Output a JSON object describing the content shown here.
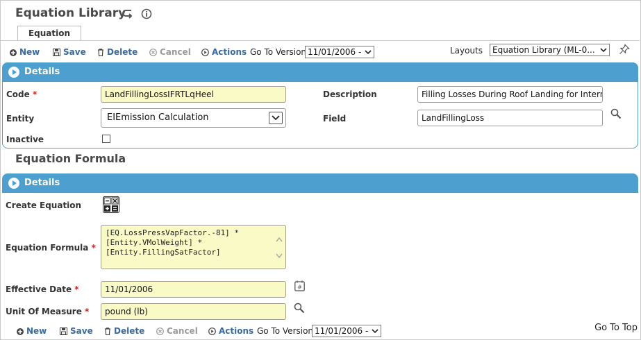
{
  "page": {
    "title": "Equation Library",
    "tab": "Equation"
  },
  "toolbar": {
    "new_label": "New",
    "save_label": "Save",
    "delete_label": "Delete",
    "cancel_label": "Cancel",
    "actions_label": "Actions",
    "goto_version_label": "Go To Version",
    "goto_version_value": "11/01/2006 -",
    "layouts_label": "Layouts",
    "layouts_value": "Equation Library (ML-0..."
  },
  "details": {
    "header": "Details",
    "code_label": "Code",
    "code_value": "LandFillingLossIFRTLqHeel",
    "description_label": "Description",
    "description_value": "Filling Losses During Roof Landing for Internal F",
    "entity_label": "Entity",
    "entity_value": "EIEmission Calculation",
    "field_label": "Field",
    "field_value": "LandFillingLoss",
    "inactive_label": "Inactive",
    "required_mark": "*"
  },
  "formula_section": {
    "title": "Equation Formula",
    "header": "Details",
    "create_label": "Create Equation",
    "formula_label": "Equation Formula",
    "formula_lines": [
      "[EQ.LossPressVapFactor.-81] *",
      "[Entity.VMolWeight] *",
      "[Entity.FillingSatFactor]"
    ],
    "effective_date_label": "Effective Date",
    "effective_date_value": "11/01/2006",
    "uom_label": "Unit Of Measure",
    "uom_value": "pound (lb)",
    "required_mark": "*"
  },
  "footer": {
    "goto_top": "Go To Top"
  },
  "colors": {
    "accent": "#4d9fd0",
    "link": "#3a6aa0",
    "required_field_bg": "#fafac6",
    "required_star": "#d0201a"
  },
  "icons": [
    "back-icon",
    "info-icon",
    "plus-icon",
    "save-icon",
    "trash-icon",
    "cancel-icon",
    "actions-icon",
    "pin-icon",
    "chevron-right-icon",
    "search-icon",
    "calculator-icon",
    "calendar-icon"
  ]
}
